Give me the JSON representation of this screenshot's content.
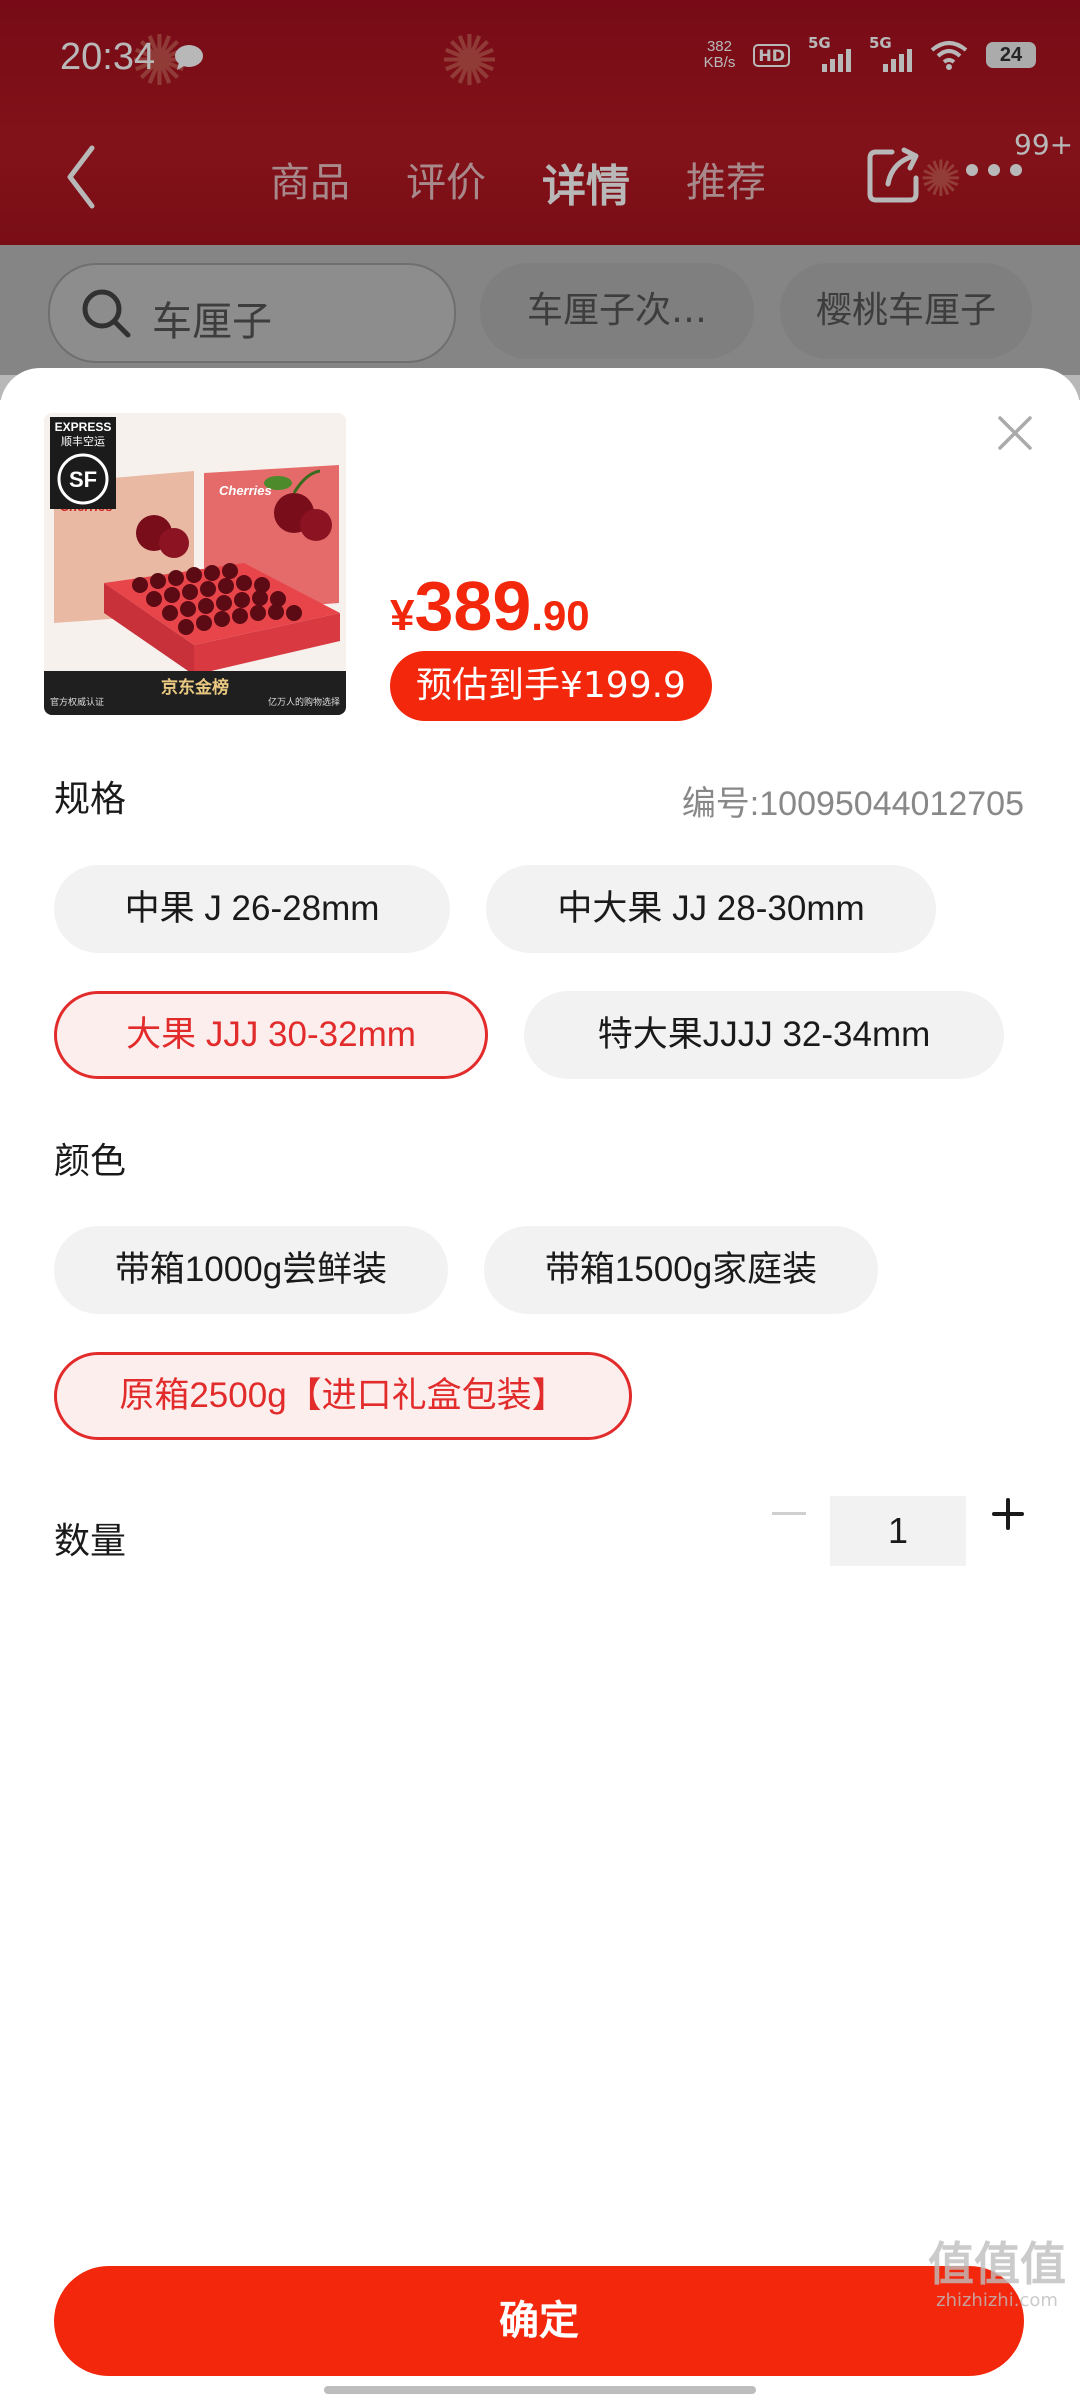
{
  "status_bar": {
    "time": "20:34",
    "net_speed_value": "382",
    "net_speed_unit": "KB/s",
    "hd_label": "HD",
    "sim1_label": "5G",
    "sim2_label": "5G",
    "battery": "24"
  },
  "nav": {
    "tabs": [
      {
        "label": "商品"
      },
      {
        "label": "评价"
      },
      {
        "label": "详情"
      },
      {
        "label": "推荐"
      }
    ],
    "active_tab": "详情",
    "more_badge": "99+"
  },
  "search": {
    "query": "车厘子",
    "chips": [
      {
        "label": "车厘子次…"
      },
      {
        "label": "樱桃车厘子"
      }
    ]
  },
  "product": {
    "image_texts": {
      "express": "EXPRESS",
      "express_cn": "顺丰空运",
      "brand": "京东金榜",
      "left_caption": "官方权威认证",
      "right_caption": "亿万人的购物选择",
      "box_label": "Cherries"
    },
    "price_symbol": "¥",
    "price_int": "389",
    "price_dec": ".90",
    "estimated_price": "预估到手¥199.9",
    "sku_number": "编号:10095044012705"
  },
  "spec": {
    "title": "规格",
    "options": [
      {
        "label": "中果 J 26-28mm",
        "selected": false
      },
      {
        "label": "中大果 JJ 28-30mm",
        "selected": false
      },
      {
        "label": "大果 JJJ 30-32mm",
        "selected": true
      },
      {
        "label": "特大果JJJJ 32-34mm",
        "selected": false
      }
    ]
  },
  "color": {
    "title": "颜色",
    "options": [
      {
        "label": "带箱1000g尝鲜装",
        "selected": false
      },
      {
        "label": "带箱1500g家庭装",
        "selected": false
      },
      {
        "label": "原箱2500g【进口礼盒包装】",
        "selected": true
      }
    ]
  },
  "quantity": {
    "title": "数量",
    "value": "1"
  },
  "confirm_label": "确定",
  "watermark": {
    "main": "值值值",
    "sub": "zhizhizhi.com"
  },
  "colors": {
    "accent": "#f2270c",
    "header_red": "#b51a24",
    "selected_border": "#e22b2b",
    "selected_bg": "#fdeeee",
    "option_bg": "#f2f2f2"
  }
}
